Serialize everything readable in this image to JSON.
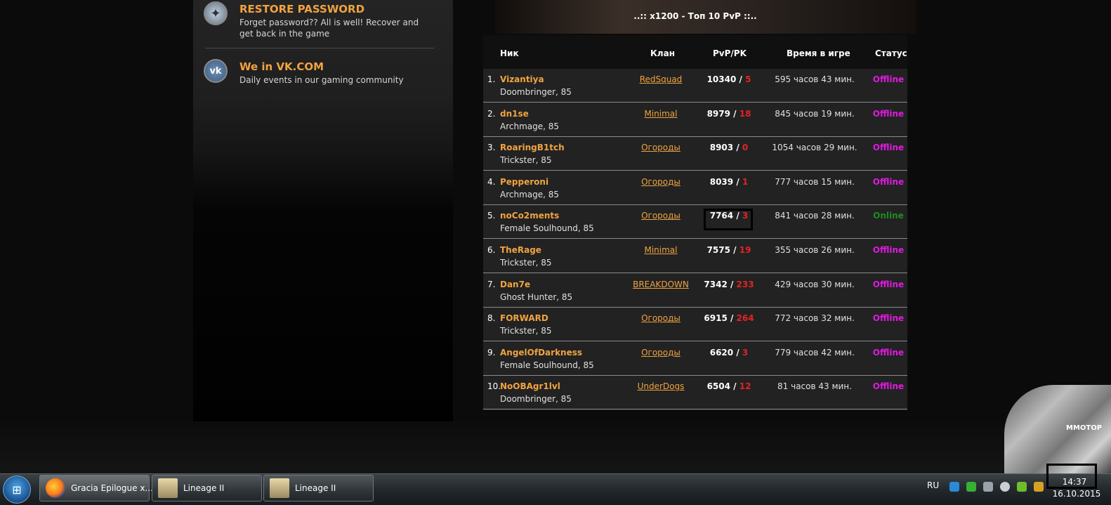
{
  "sidebar": {
    "restore": {
      "title": "RESTORE PASSWORD",
      "text": "Forget password?? All is well! Recover and get back in the game"
    },
    "vk": {
      "icon_text": "vk",
      "title": "We in VK.COM",
      "text": "Daily events in our gaming community"
    }
  },
  "top10": {
    "title": "..:: x1200 - Топ 10 PvP ::..",
    "headers": {
      "nick": "Ник",
      "clan": "Клан",
      "pvp": "PvP/PK",
      "time": "Время в игре",
      "status": "Статус"
    },
    "rows": [
      {
        "num": "1.",
        "nick": "Vizantiya",
        "sub": "Doombringer, 85",
        "clan": "RedSquad",
        "pvp": "10340",
        "pk": "5",
        "time": "595 часов 43 мин.",
        "status": "Offline"
      },
      {
        "num": "2.",
        "nick": "dn1se",
        "sub": "Archmage, 85",
        "clan": "Minimal",
        "pvp": "8979",
        "pk": "18",
        "time": "845 часов 19 мин.",
        "status": "Offline"
      },
      {
        "num": "3.",
        "nick": "RoaringB1tch",
        "sub": "Trickster, 85",
        "clan": "Огороды",
        "pvp": "8903",
        "pk": "0",
        "time": "1054 часов 29 мин.",
        "status": "Offline"
      },
      {
        "num": "4.",
        "nick": "Pepperoni",
        "sub": "Archmage, 85",
        "clan": "Огороды",
        "pvp": "8039",
        "pk": "1",
        "time": "777 часов 15 мин.",
        "status": "Offline"
      },
      {
        "num": "5.",
        "nick": "noCo2ments",
        "sub": "Female Soulhound, 85",
        "clan": "Огороды",
        "pvp": "7764",
        "pk": "3",
        "time": "841 часов 28 мин.",
        "status": "Online"
      },
      {
        "num": "6.",
        "nick": "TheRage",
        "sub": "Trickster, 85",
        "clan": "Minimal",
        "pvp": "7575",
        "pk": "19",
        "time": "355 часов 26 мин.",
        "status": "Offline"
      },
      {
        "num": "7.",
        "nick": "Dan7e",
        "sub": "Ghost Hunter, 85",
        "clan": "BREAKDOWN",
        "pvp": "7342",
        "pk": "233",
        "time": "429 часов 30 мин.",
        "status": "Offline"
      },
      {
        "num": "8.",
        "nick": "FORWARD",
        "sub": "Trickster, 85",
        "clan": "Огороды",
        "pvp": "6915",
        "pk": "264",
        "time": "772 часов 32 мин.",
        "status": "Offline"
      },
      {
        "num": "9.",
        "nick": "AngelOfDarkness",
        "sub": "Female Soulhound, 85",
        "clan": "Огороды",
        "pvp": "6620",
        "pk": "3",
        "time": "779 часов 42 мин.",
        "status": "Offline"
      },
      {
        "num": "10.",
        "nick": "NoOBAgr1lvl",
        "sub": "Doombringer, 85",
        "clan": "UnderDogs",
        "pvp": "6504",
        "pk": "12",
        "time": "81 часов 43 мин.",
        "status": "Offline"
      }
    ],
    "sep": " / "
  },
  "mascot": {
    "text": "MMOTOP"
  },
  "taskbar": {
    "items": [
      {
        "label": "Gracia Epilogue x...",
        "icon": "firefox-icon"
      },
      {
        "label": "Lineage II",
        "icon": "lineage-icon"
      },
      {
        "label": "Lineage II",
        "icon": "lineage-icon"
      }
    ],
    "lang": "RU",
    "time": "14:37",
    "date": "16.10.2015"
  },
  "colors": {
    "accent": "#f0a340",
    "pk": "#e52222",
    "offline": "#e019e0",
    "online": "#1e8c1e"
  }
}
